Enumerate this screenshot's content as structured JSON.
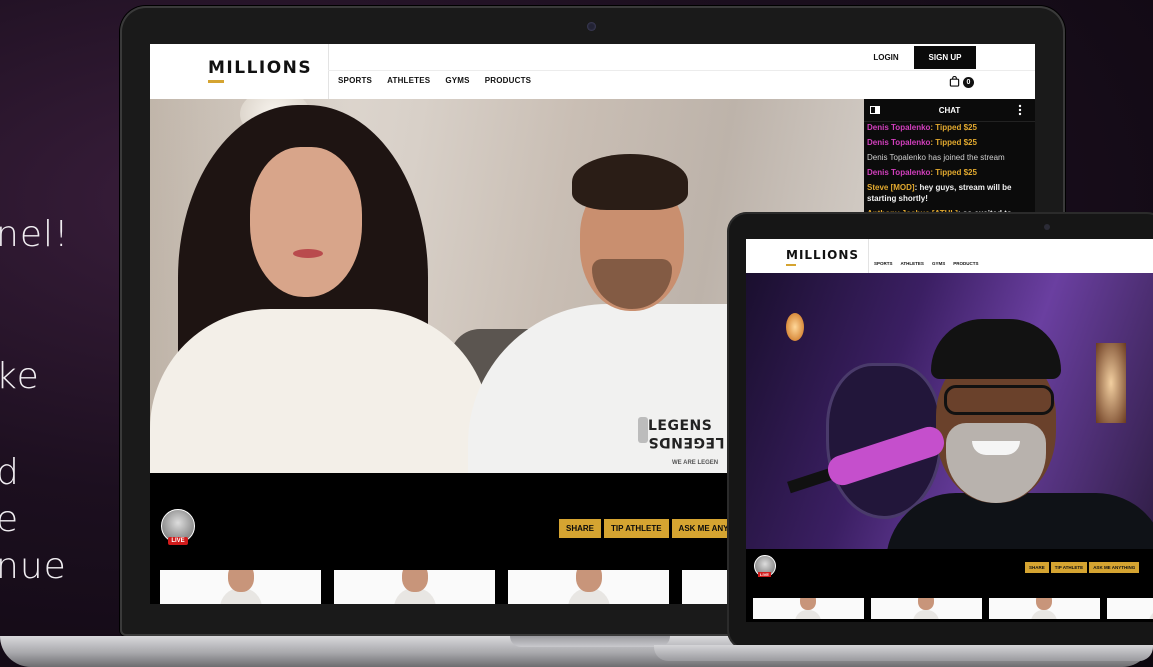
{
  "background_text": {
    "lines": [
      "nel!",
      "ke",
      "d",
      "e",
      "nue"
    ]
  },
  "laptop": {
    "header": {
      "logo": "MILLIONS",
      "nav": [
        "SPORTS",
        "ATHLETES",
        "GYMS",
        "PRODUCTS"
      ],
      "login": "LOGIN",
      "signup": "SIGN UP",
      "cart_count": "0"
    },
    "video": {
      "shirt_text_top": "LEGENS",
      "shirt_text_bottom": "LEGENDS",
      "shirt_small": "WE ARE LEGEN"
    },
    "chat": {
      "title": "CHAT",
      "messages": [
        {
          "user": "Denis Topalenko",
          "text": ": Tipped $25"
        },
        {
          "user": "Denis Topalenko",
          "text": ": Tipped $25"
        },
        {
          "system": "Denis Topalenko has joined the stream"
        },
        {
          "user": "Denis Topalenko",
          "text": ": Tipped $25"
        },
        {
          "user": "Steve [MOD]",
          "text": ": hey guys, stream will be starting shortly!"
        },
        {
          "user": "Anthony Joshua [ATHL]",
          "text": ": so excited to"
        }
      ]
    },
    "live_badge": "LIVE",
    "actions": [
      "SHARE",
      "TIP ATHLETE",
      "ASK ME ANY"
    ]
  },
  "tablet": {
    "header": {
      "logo": "MILLIONS",
      "nav": [
        "SPORTS",
        "ATHLETES",
        "GYMS",
        "PRODUCTS"
      ]
    },
    "live_badge": "LIVE",
    "actions": [
      "SHARE",
      "TIP ATHLETE",
      "ASK ME ANYTHING"
    ]
  },
  "colors": {
    "accent_gold": "#d5a431",
    "chat_pink": "#d23fbd",
    "chat_gold": "#e2a92f",
    "live_red": "#d11b1b"
  }
}
